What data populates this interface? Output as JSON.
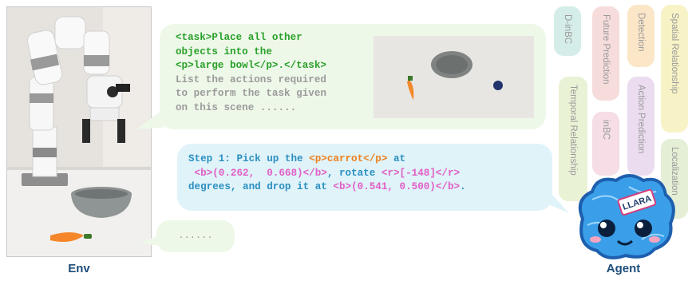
{
  "env": {
    "label": "Env"
  },
  "agent": {
    "label": "Agent",
    "badge_text": "LLARA"
  },
  "task_bubble": {
    "line1": "<task>Place all other",
    "line2": "objects into the",
    "line3_p": "<p>large bowl</p>",
    "line3_rest": ".</task>",
    "grey1": "List the actions required",
    "grey2": "to perform the task given",
    "grey3": "on this scene ......"
  },
  "step_bubble": {
    "a1": "Step 1: Pick up the ",
    "a2": "<p>carrot</p>",
    "a3": " at",
    "b1": " <b>(0.262,  0.668)</b>",
    "b2": ", rotate ",
    "b3": "<r>[-148]</r>",
    "c1": "degrees, and drop it at ",
    "c2": "<b>(0.541, 0.500)</b>",
    "c3": "."
  },
  "ellipsis_bubble": {
    "text": "......"
  },
  "skill_cards": [
    {
      "label": "D-inBC",
      "color": "#d5ede8"
    },
    {
      "label": "Future Prediction",
      "color": "#f7dcdc"
    },
    {
      "label": "Detection",
      "color": "#fbe6c8"
    },
    {
      "label": "Spatial Relationship",
      "color": "#f8f3c6"
    },
    {
      "label": "Temporal Relationship",
      "color": "#eaf2d6"
    },
    {
      "label": "inBC",
      "color": "#f6dde6"
    },
    {
      "label": "Action Prediction",
      "color": "#ebdcf0"
    },
    {
      "label": "Localization",
      "color": "#e4efd6"
    }
  ],
  "colors": {
    "task_green": "#2aa02a",
    "prompt_grey": "#9b9b9b",
    "step_blue": "#2b8fc1",
    "token_p": "#f07f1b",
    "token_b": "#e25ec6",
    "label_navy": "#1f4e79"
  }
}
